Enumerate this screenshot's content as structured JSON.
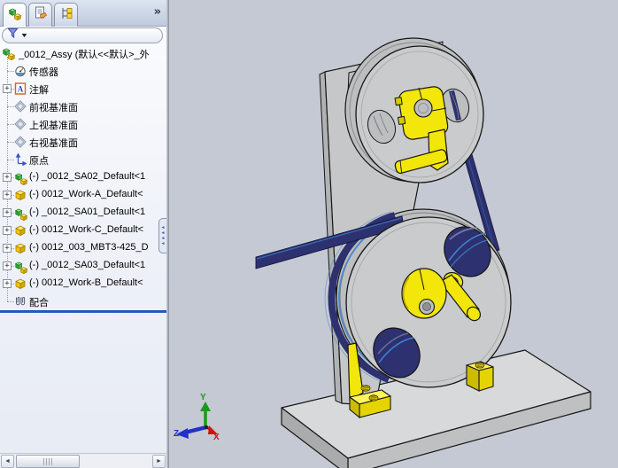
{
  "panel": {
    "tabs": [
      {
        "icon": "featuremanager-tree-icon"
      },
      {
        "icon": "propertymanager-icon"
      },
      {
        "icon": "configurationmanager-icon"
      }
    ],
    "overflow_label": "»",
    "filter": {
      "icon": "filter-funnel-icon",
      "caret": "▼"
    },
    "tree": [
      {
        "label": "_0012_Assy  (默认<<默认>_外",
        "icon": "assembly",
        "level": 0,
        "expand": false
      },
      {
        "label": "传感器",
        "icon": "sensors",
        "level": 1,
        "expand": false
      },
      {
        "label": "注解",
        "icon": "annotations",
        "level": 1,
        "expand": true
      },
      {
        "label": "前视基准面",
        "icon": "plane",
        "level": 1,
        "expand": false
      },
      {
        "label": "上视基准面",
        "icon": "plane",
        "level": 1,
        "expand": false
      },
      {
        "label": "右视基准面",
        "icon": "plane",
        "level": 1,
        "expand": false
      },
      {
        "label": "原点",
        "icon": "origin",
        "level": 1,
        "expand": false
      },
      {
        "label": "(-) _0012_SA02_Default<1",
        "icon": "subassembly",
        "level": 1,
        "expand": true
      },
      {
        "label": "(-) 0012_Work-A_Default<",
        "icon": "part",
        "level": 1,
        "expand": true
      },
      {
        "label": "(-) _0012_SA01_Default<1",
        "icon": "subassembly",
        "level": 1,
        "expand": true
      },
      {
        "label": "(-) 0012_Work-C_Default<",
        "icon": "part",
        "level": 1,
        "expand": true
      },
      {
        "label": "(-) 0012_003_MBT3-425_D",
        "icon": "part",
        "level": 1,
        "expand": true
      },
      {
        "label": "(-) _0012_SA03_Default<1",
        "icon": "subassembly",
        "level": 1,
        "expand": true
      },
      {
        "label": "(-) 0012_Work-B_Default<",
        "icon": "part",
        "level": 1,
        "expand": true
      },
      {
        "label": "配合",
        "icon": "mates",
        "level": 1,
        "expand": false
      }
    ],
    "scrollbar": {
      "left": "◄",
      "right": "►"
    },
    "expander_glyph": "+"
  },
  "viewport": {
    "triad": {
      "x": "X",
      "y": "Y",
      "z": "Z"
    }
  },
  "colors": {
    "viewport_bg": "#c5c9d3",
    "part_yellow": "#f2e60a",
    "band_navy": "#2d3170",
    "band_blue": "#3f84d0",
    "axis_x": "#cc1414",
    "axis_y": "#1a9a1a",
    "axis_z": "#2030c8",
    "splitter_blue": "#2a66c8"
  }
}
